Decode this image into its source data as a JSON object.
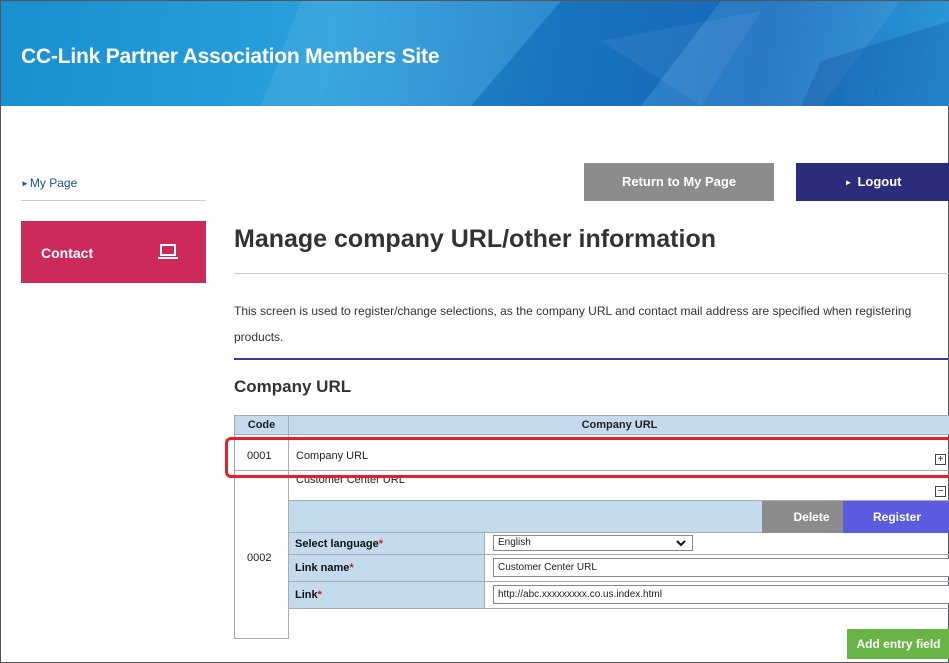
{
  "header": {
    "title": "CC-Link Partner Association Members Site"
  },
  "sidebar": {
    "my_page_link": "My Page",
    "contact_label": "Contact"
  },
  "top_buttons": {
    "return_label": "Return to My Page",
    "logout_label": "Logout"
  },
  "page": {
    "title": "Manage company URL/other information",
    "description": "This screen is used to register/change selections, as the company URL and contact mail address are specified when registering products.",
    "section_title": "Company URL"
  },
  "table": {
    "headers": {
      "code": "Code",
      "company_url": "Company URL"
    },
    "rows": [
      {
        "code": "0001",
        "name": "Company URL",
        "state": "collapsed"
      },
      {
        "code": "0002",
        "name": "Customer Center URL",
        "state": "expanded"
      }
    ],
    "actions": {
      "delete_label": "Delete",
      "register_label": "Register"
    },
    "form": {
      "language_label": "Select language",
      "language_value": "English",
      "link_name_label": "Link name",
      "link_name_value": "Customer Center URL",
      "link_label": "Link",
      "link_value": "http://abc.xxxxxxxxx.co.us.index.html",
      "required_mark": "*"
    }
  },
  "add_entry_label": "Add entry field",
  "icons": {
    "expand": "plus-box-icon",
    "collapse": "minus-box-icon",
    "contact": "laptop-icon",
    "arrow": "triangle-right-icon"
  },
  "colors": {
    "contact": "#cc2a5a",
    "logout": "#2b2d7a",
    "register": "#5b5ce0",
    "add": "#6ab445",
    "highlight": "#e0202a"
  }
}
